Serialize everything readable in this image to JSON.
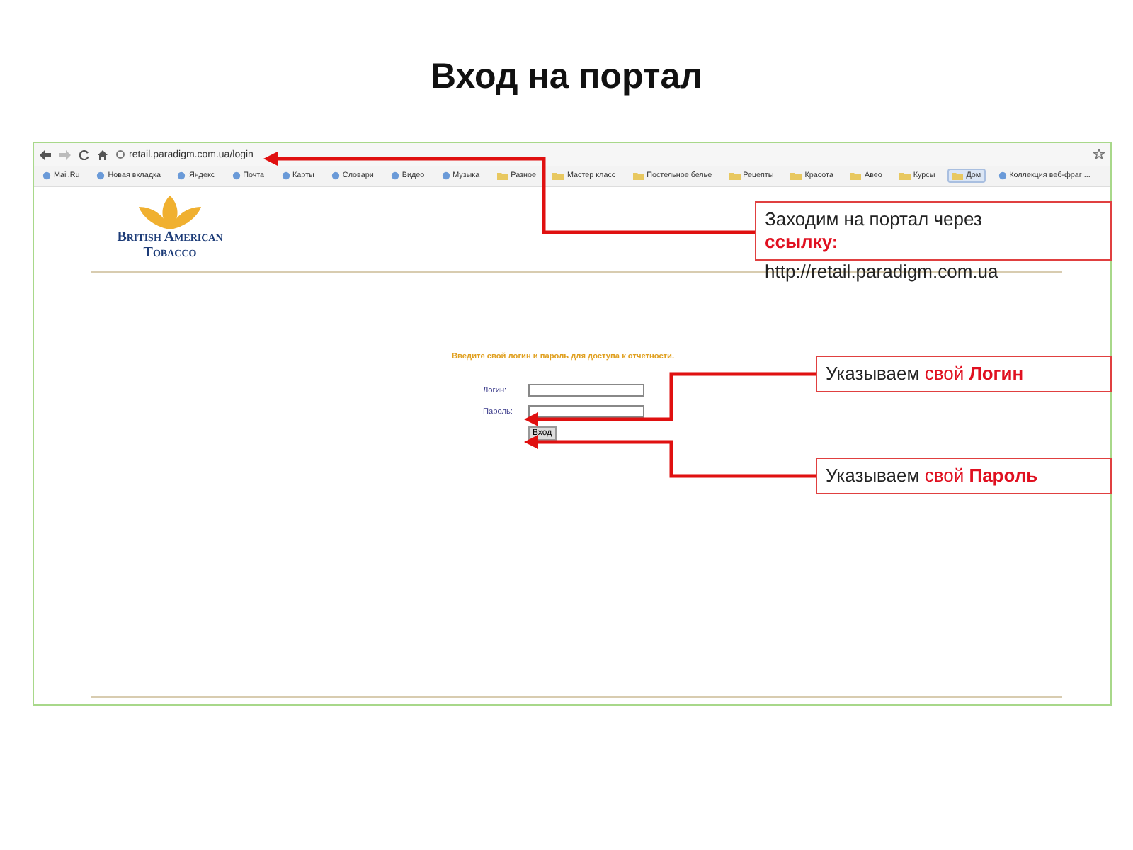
{
  "slide_title": "Вход на портал",
  "browser": {
    "address": "retail.paradigm.com.ua/login",
    "bookmarks": [
      {
        "label": "Mail.Ru",
        "kind": "site",
        "selected": false
      },
      {
        "label": "Новая вкладка",
        "kind": "site",
        "selected": false
      },
      {
        "label": "Яндекс",
        "kind": "site",
        "selected": false
      },
      {
        "label": "Почта",
        "kind": "site",
        "selected": false
      },
      {
        "label": "Карты",
        "kind": "site",
        "selected": false
      },
      {
        "label": "Словари",
        "kind": "site",
        "selected": false
      },
      {
        "label": "Видео",
        "kind": "site",
        "selected": false
      },
      {
        "label": "Музыка",
        "kind": "site",
        "selected": false
      },
      {
        "label": "Разное",
        "kind": "folder",
        "selected": false
      },
      {
        "label": "Мастер класс",
        "kind": "folder",
        "selected": false
      },
      {
        "label": "Постельное белье",
        "kind": "folder",
        "selected": false
      },
      {
        "label": "Рецепты",
        "kind": "folder",
        "selected": false
      },
      {
        "label": "Красота",
        "kind": "folder",
        "selected": false
      },
      {
        "label": "Авео",
        "kind": "folder",
        "selected": false
      },
      {
        "label": "Курсы",
        "kind": "folder",
        "selected": false
      },
      {
        "label": "Дом",
        "kind": "folder",
        "selected": true
      },
      {
        "label": "Коллекция веб-фраг ...",
        "kind": "site",
        "selected": false
      }
    ]
  },
  "page": {
    "logo_lines": [
      "British American",
      "Tobacco"
    ],
    "form": {
      "hint": "Введите свой логин и пароль для доступа к отчетности.",
      "fields": [
        {
          "label": "Логин:"
        },
        {
          "label": "Пароль:"
        }
      ],
      "submit": "Вход"
    }
  },
  "callouts": [
    {
      "parts": [
        {
          "text": "Заходим на портал через",
          "kind": "plain"
        },
        {
          "text": "ссылку:",
          "kind": "strong"
        }
      ],
      "link": "http://retail.paradigm.com.ua"
    },
    {
      "parts": [
        {
          "text": "Указываем",
          "kind": "plain"
        },
        {
          "text": "свой",
          "kind": "accent"
        },
        {
          "text": "Логин",
          "kind": "strong"
        }
      ]
    },
    {
      "parts": [
        {
          "text": "Указываем",
          "kind": "plain"
        },
        {
          "text": "свой",
          "kind": "accent"
        },
        {
          "text": "Пароль",
          "kind": "strong"
        }
      ]
    }
  ]
}
